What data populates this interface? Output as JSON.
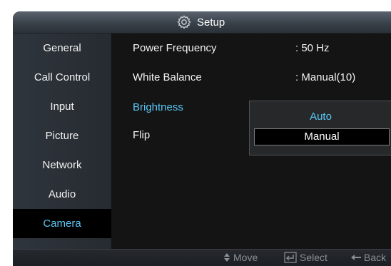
{
  "title": "Setup",
  "sidebar": {
    "items": [
      {
        "label": "General"
      },
      {
        "label": "Call Control"
      },
      {
        "label": "Input"
      },
      {
        "label": "Picture"
      },
      {
        "label": "Network"
      },
      {
        "label": "Audio"
      },
      {
        "label": "Camera",
        "active": true
      }
    ]
  },
  "settings": [
    {
      "label": "Power Frequency",
      "value": ": 50 Hz"
    },
    {
      "label": "White Balance",
      "value": ": Manual(10)"
    },
    {
      "label": "Brightness",
      "value": ""
    },
    {
      "label": "Flip",
      "value": ""
    }
  ],
  "dropdown": {
    "options": [
      "Auto",
      "Manual"
    ],
    "selected": "Manual"
  },
  "footer": {
    "move": "Move",
    "select": "Select",
    "back": "Back"
  },
  "icons": {
    "title": "gear-icon",
    "move": "up-down-arrows-icon",
    "select": "enter-key-icon",
    "back": "left-arrow-icon"
  },
  "colors": {
    "accent": "#59c7f5",
    "background": "#141414",
    "text": "#f2f2f2"
  }
}
